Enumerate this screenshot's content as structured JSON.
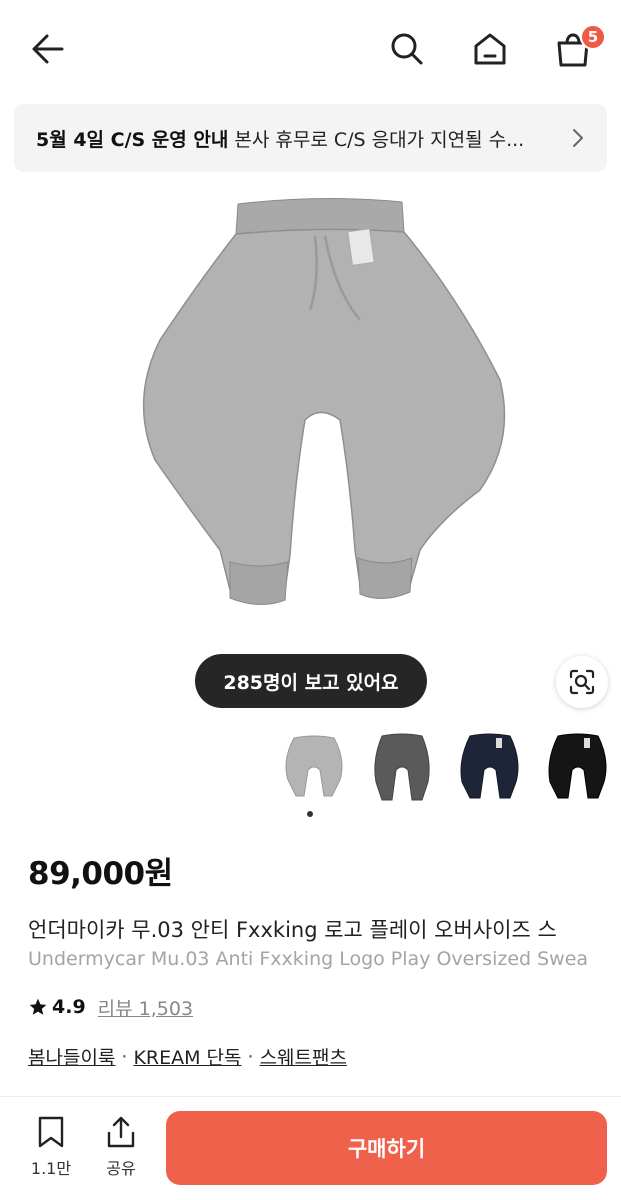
{
  "header": {
    "cart_badge": "5"
  },
  "notice": {
    "title": "5월 4일 C/S 운영 안내",
    "body": "본사 휴무로 C/S 응대가 지연될 수..."
  },
  "viewers": "285명이 보고 있어요",
  "color_thumbs": [
    "gray-thumbnail",
    "charcoal-thumbnail",
    "navy-thumbnail",
    "black-thumbnail"
  ],
  "product": {
    "price": "89,000원",
    "name_ko": "언더마이카 무.03 안티 Fxxking 로고 플레이 오버사이즈 스",
    "name_en": "Undermycar Mu.03 Anti Fxxking Logo Play Oversized Swea",
    "rating": "4.9",
    "review_label": "리뷰 1,503",
    "tags": [
      "봄나들이룩",
      "KREAM 단독",
      "스웨트팬츠"
    ]
  },
  "bottom_bar": {
    "like_count": "1.1만",
    "share_label": "공유",
    "buy_label": "구매하기"
  },
  "colors": {
    "accent": "#f0614b",
    "badge": "#f05a44"
  }
}
